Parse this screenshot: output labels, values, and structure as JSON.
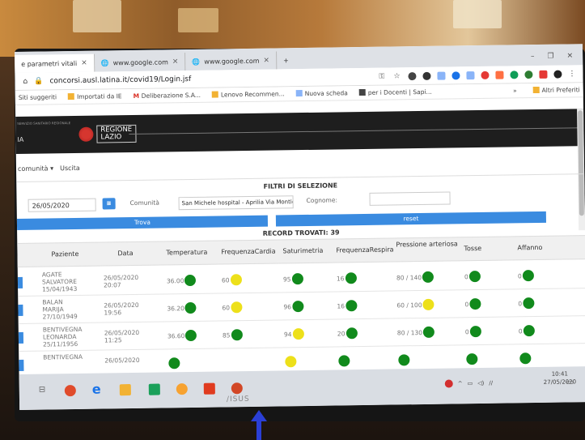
{
  "browser": {
    "tabs": [
      {
        "title": "e parametri vitali",
        "close": "×"
      },
      {
        "title": "www.google.com",
        "close": "×"
      },
      {
        "title": "www.google.com",
        "close": "×"
      }
    ],
    "new_tab": "+",
    "url": "concorsi.ausl.latina.it/covid19/Login.jsf",
    "bookmarks": [
      "Siti suggeriti",
      "Importati da IE",
      "Deliberazione S.A...",
      "Lenovo Recommen...",
      "Nuova scheda",
      "per i Docenti | Sapi..."
    ],
    "bookmarks_more": "»",
    "other_bookmarks": "Altri Preferiti"
  },
  "header": {
    "small_text": "SERVIZIO SANITARIO REGIONALE",
    "left_text": "IA",
    "brand_line1": "REGIONE",
    "brand_line2": "LAZIO"
  },
  "nav": {
    "menu": "comunità ▾",
    "exit": "Uscita"
  },
  "filters": {
    "title": "FILTRI DI SELEZIONE",
    "date_value": "26/05/2020",
    "comunita_label": "Comunità",
    "comunita_value": "San Michele hospital - Aprilia Via Monticelli",
    "cognome_label": "Cognome:",
    "cognome_value": "",
    "search_button": "Trova",
    "reset_button": "reset"
  },
  "results": {
    "record_count": "RECORD TROVATI: 39",
    "columns": [
      "Paziente",
      "Data",
      "Temperatura",
      "FrequenzaCardia",
      "Saturimetria",
      "FrequenzaRespira",
      "Pressione arteriosa",
      "Tosse",
      "Affanno"
    ],
    "rows": [
      {
        "name": [
          "AGATE",
          "SALVATORE",
          "15/04/1943"
        ],
        "date": [
          "26/05/2020",
          "20:07"
        ],
        "temp": "36.00",
        "temp_c": "green",
        "hr": "60",
        "hr_c": "yellow",
        "sat": "95",
        "sat_c": "green",
        "rr": "16",
        "rr_c": "green",
        "bp": "80 / 140",
        "bp_c": "green",
        "cough": "0",
        "cough_c": "green",
        "dysp": "0",
        "dysp_c": "green"
      },
      {
        "name": [
          "BALAN",
          "MARIJA",
          "27/10/1949"
        ],
        "date": [
          "26/05/2020",
          "19:56"
        ],
        "temp": "36.20",
        "temp_c": "green",
        "hr": "60",
        "hr_c": "yellow",
        "sat": "96",
        "sat_c": "green",
        "rr": "16",
        "rr_c": "green",
        "bp": "60 / 100",
        "bp_c": "yellow",
        "cough": "0",
        "cough_c": "green",
        "dysp": "0",
        "dysp_c": "green"
      },
      {
        "name": [
          "BENTIVEGNA",
          "LEONARDA",
          "25/11/1956"
        ],
        "date": [
          "26/05/2020",
          "11:25"
        ],
        "temp": "36.60",
        "temp_c": "green",
        "hr": "85",
        "hr_c": "green",
        "sat": "94",
        "sat_c": "yellow",
        "rr": "20",
        "rr_c": "green",
        "bp": "80 / 130",
        "bp_c": "green",
        "cough": "0",
        "cough_c": "green",
        "dysp": "0",
        "dysp_c": "green"
      },
      {
        "name": [
          "BENTIVEGNA",
          "",
          ""
        ],
        "date": [
          "26/05/2020",
          ""
        ],
        "temp": "",
        "temp_c": "green",
        "hr": "",
        "hr_c": "",
        "sat": "",
        "sat_c": "yellow",
        "rr": "",
        "rr_c": "green",
        "bp": "",
        "bp_c": "green",
        "cough": "",
        "cough_c": "green",
        "dysp": "",
        "dysp_c": "green"
      }
    ]
  },
  "taskbar": {
    "time": "10:41",
    "date": "27/05/2020"
  },
  "monitor_brand": "/ISUS"
}
